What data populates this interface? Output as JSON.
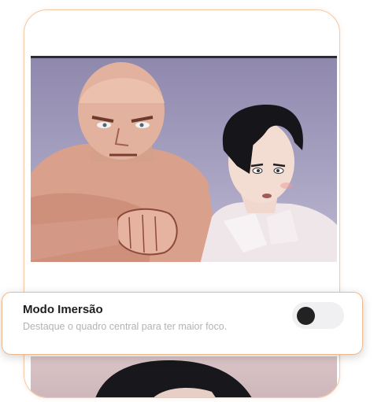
{
  "comic": {
    "panel_count_visible": 2,
    "panel_background": "#9e98ba"
  },
  "immersion_setting": {
    "title": "Modo Imersão",
    "description": "Destaque o quadro central para ter maior foco.",
    "enabled": false,
    "accent_border": "#f0b98d"
  }
}
